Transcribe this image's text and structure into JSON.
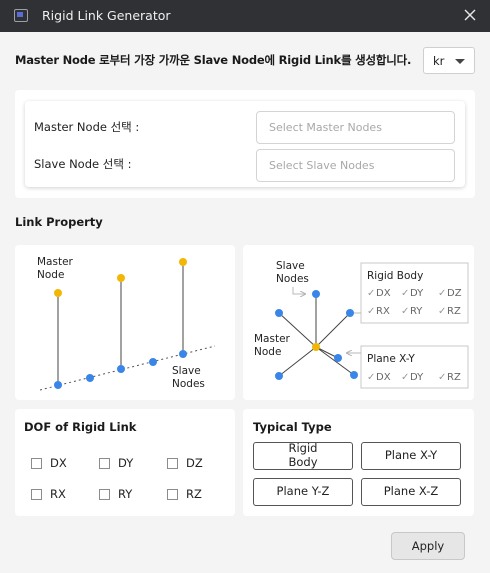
{
  "window": {
    "title": "Rigid Link Generator",
    "close_icon": "close-icon"
  },
  "headline": "Master Node 로부터 가장 가까운 Slave Node에 Rigid Link를 생성합니다.",
  "language": {
    "value": "kr"
  },
  "selection": {
    "master_label": "Master Node 선택 :",
    "master_placeholder": "Select Master Nodes",
    "master_value": "",
    "slave_label": "Slave Node 선택 :",
    "slave_placeholder": "Select Slave Nodes",
    "slave_value": ""
  },
  "link_property": {
    "title": "Link Property",
    "left_diagram": {
      "master_label_1": "Master",
      "master_label_2": "Node",
      "slave_label_1": "Slave",
      "slave_label_2": "Nodes"
    },
    "right_diagram": {
      "slave_label_1": "Slave",
      "slave_label_2": "Nodes",
      "master_label_1": "Master",
      "master_label_2": "Node",
      "rigid_body_title": "Rigid Body",
      "rigid_body_dofs": [
        "DX",
        "DY",
        "DZ",
        "RX",
        "RY",
        "RZ"
      ],
      "plane_title": "Plane X-Y",
      "plane_dofs": [
        "DX",
        "DY",
        "RZ"
      ]
    }
  },
  "dof": {
    "title": "DOF of Rigid Link",
    "items": [
      {
        "label": "DX",
        "checked": false
      },
      {
        "label": "DY",
        "checked": false
      },
      {
        "label": "DZ",
        "checked": false
      },
      {
        "label": "RX",
        "checked": false
      },
      {
        "label": "RY",
        "checked": false
      },
      {
        "label": "RZ",
        "checked": false
      }
    ]
  },
  "typical_type": {
    "title": "Typical Type",
    "buttons": [
      {
        "line1": "Rigid",
        "line2": "Body"
      },
      {
        "line1": "Plane X-Y",
        "line2": ""
      },
      {
        "line1": "Plane Y-Z",
        "line2": ""
      },
      {
        "line1": "Plane X-Z",
        "line2": ""
      }
    ]
  },
  "apply_label": "Apply",
  "colors": {
    "master_node": "#f2b705",
    "slave_node": "#3a86e8",
    "titlebar": "#2f3135"
  }
}
